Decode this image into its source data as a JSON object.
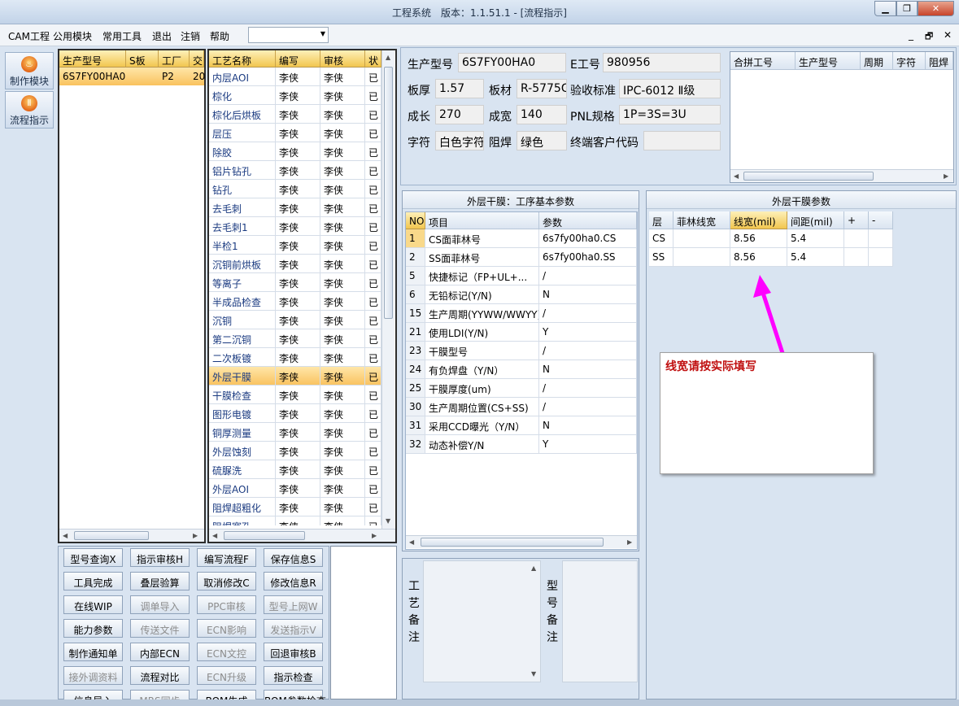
{
  "window": {
    "title": "工程系统　版本：1.1.51.1 - [流程指示]",
    "minimize": "▁",
    "restore": "❐",
    "close": "✕"
  },
  "menu": {
    "items": [
      "CAM工程",
      "公用模块",
      "常用工具",
      "退出",
      "注销",
      "帮助"
    ],
    "combo_value": "",
    "mdi_min": "_",
    "mdi_restore": "🗗",
    "mdi_close": "✕"
  },
  "sidebar": {
    "items": [
      {
        "label": "制作模块",
        "icon": "flame-icon"
      },
      {
        "label": "流程指示",
        "icon": "pause-icon"
      }
    ]
  },
  "product_grid": {
    "headers": [
      "生产型号",
      "S板",
      "工厂",
      "交"
    ],
    "rows": [
      [
        "6S7FY00HA0",
        "",
        "P2",
        "20"
      ]
    ]
  },
  "process_grid": {
    "headers": [
      "工艺名称",
      "编写",
      "审核",
      "状"
    ],
    "rows": [
      [
        "内层AOI",
        "李侠",
        "李侠",
        "已"
      ],
      [
        "棕化",
        "李侠",
        "李侠",
        "已"
      ],
      [
        "棕化后烘板",
        "李侠",
        "李侠",
        "已"
      ],
      [
        "层压",
        "李侠",
        "李侠",
        "已"
      ],
      [
        "除胶",
        "李侠",
        "李侠",
        "已"
      ],
      [
        "铝片钻孔",
        "李侠",
        "李侠",
        "已"
      ],
      [
        "钻孔",
        "李侠",
        "李侠",
        "已"
      ],
      [
        "去毛刺",
        "李侠",
        "李侠",
        "已"
      ],
      [
        "去毛刺1",
        "李侠",
        "李侠",
        "已"
      ],
      [
        "半检1",
        "李侠",
        "李侠",
        "已"
      ],
      [
        "沉铜前烘板",
        "李侠",
        "李侠",
        "已"
      ],
      [
        "等离子",
        "李侠",
        "李侠",
        "已"
      ],
      [
        "半成品检查",
        "李侠",
        "李侠",
        "已"
      ],
      [
        "沉铜",
        "李侠",
        "李侠",
        "已"
      ],
      [
        "第二沉铜",
        "李侠",
        "李侠",
        "已"
      ],
      [
        "二次板镀",
        "李侠",
        "李侠",
        "已"
      ],
      [
        "外层干膜",
        "李侠",
        "李侠",
        "已"
      ],
      [
        "干膜检查",
        "李侠",
        "李侠",
        "已"
      ],
      [
        "图形电镀",
        "李侠",
        "李侠",
        "已"
      ],
      [
        "铜厚测量",
        "李侠",
        "李侠",
        "已"
      ],
      [
        "外层蚀刻",
        "李侠",
        "李侠",
        "已"
      ],
      [
        "硫脲洗",
        "李侠",
        "李侠",
        "已"
      ],
      [
        "外层AOI",
        "李侠",
        "李侠",
        "已"
      ],
      [
        "阻焊超粗化",
        "李侠",
        "李侠",
        "已"
      ],
      [
        "阻焊塞孔",
        "李侠",
        "李侠",
        "已"
      ]
    ],
    "selected_index": 16
  },
  "buttons": {
    "rows": [
      [
        {
          "label": "型号查询X",
          "enabled": true
        },
        {
          "label": "指示审核H",
          "enabled": true
        },
        {
          "label": "编写流程F",
          "enabled": true
        },
        {
          "label": "保存信息S",
          "enabled": true
        }
      ],
      [
        {
          "label": "工具完成",
          "enabled": true
        },
        {
          "label": "叠层验算",
          "enabled": true
        },
        {
          "label": "取消修改C",
          "enabled": true
        },
        {
          "label": "修改信息R",
          "enabled": true
        }
      ],
      [
        {
          "label": "在线WIP",
          "enabled": true
        },
        {
          "label": "调单导入",
          "enabled": false
        },
        {
          "label": "PPC审核",
          "enabled": false
        },
        {
          "label": "型号上网W",
          "enabled": false
        }
      ],
      [
        {
          "label": "能力参数",
          "enabled": true
        },
        {
          "label": "传送文件",
          "enabled": false
        },
        {
          "label": "ECN影响",
          "enabled": false
        },
        {
          "label": "发送指示V",
          "enabled": false
        }
      ],
      [
        {
          "label": "制作通知单",
          "enabled": true
        },
        {
          "label": "内部ECN",
          "enabled": true
        },
        {
          "label": "ECN文控",
          "enabled": false
        },
        {
          "label": "回退审核B",
          "enabled": true
        }
      ],
      [
        {
          "label": "接外调资料",
          "enabled": false
        },
        {
          "label": "流程对比",
          "enabled": true
        },
        {
          "label": "ECN升级",
          "enabled": false
        },
        {
          "label": "指示检查",
          "enabled": true
        }
      ],
      [
        {
          "label": "信息导入",
          "enabled": true
        },
        {
          "label": "MRS同步",
          "enabled": false
        },
        {
          "label": "BOM生成",
          "enabled": true
        },
        {
          "label": "BOM参数检查",
          "enabled": true
        }
      ]
    ]
  },
  "info": {
    "model_label": "生产型号",
    "model_value": "6S7FY00HA0",
    "e_label": "E工号",
    "e_value": "980956",
    "thickness_label": "板厚",
    "thickness_value": "1.57",
    "material_label": "板材",
    "material_value": "R-5775G",
    "standard_label": "验收标准",
    "standard_value": "IPC-6012 Ⅱ级",
    "length_label": "成长",
    "length_value": "270",
    "width_label": "成宽",
    "width_value": "140",
    "pnl_label": "PNL规格",
    "pnl_value": "1P=3S=3U",
    "char_label": "字符",
    "char_value": "白色字符",
    "mask_label": "阻焊",
    "mask_value": "绿色",
    "customer_label": "终端客户代码",
    "customer_value": ""
  },
  "combine_grid": {
    "headers": [
      "合拼工号",
      "生产型号",
      "周期",
      "字符",
      "阻焊"
    ]
  },
  "params": {
    "title": "外层干膜：工序基本参数",
    "headers": [
      "NO",
      "项目",
      "参数"
    ],
    "rows": [
      [
        "1",
        "CS面菲林号",
        "6s7fy00ha0.CS"
      ],
      [
        "2",
        "SS面菲林号",
        "6s7fy00ha0.SS"
      ],
      [
        "5",
        "快捷标记（FP+UL+...",
        "/"
      ],
      [
        "6",
        "无铅标记(Y/N)",
        "N"
      ],
      [
        "15",
        "生产周期(YYWW/WWYY)",
        "/"
      ],
      [
        "21",
        "使用LDI(Y/N)",
        "Y"
      ],
      [
        "23",
        "干膜型号",
        "/"
      ],
      [
        "24",
        "有负焊盘（Y/N）",
        "N"
      ],
      [
        "25",
        "干膜厚度(um)",
        "/"
      ],
      [
        "30",
        "生产周期位置(CS+SS)",
        "/"
      ],
      [
        "31",
        "采用CCD曝光（Y/N）",
        "N"
      ],
      [
        "32",
        "动态补偿Y/N",
        "Y"
      ]
    ]
  },
  "dryfilm": {
    "title": "外层干膜参数",
    "headers": [
      "层",
      "菲林线宽",
      "线宽(mil)",
      "间距(mil)",
      "+",
      "-"
    ],
    "rows": [
      [
        "CS",
        "",
        "8.56",
        "5.4",
        "",
        ""
      ],
      [
        "SS",
        "",
        "8.56",
        "5.4",
        "",
        ""
      ]
    ]
  },
  "annotation": {
    "text": "线宽请按实际填写",
    "color": "#ff00ff"
  },
  "remarks": {
    "process_label": "工艺备注",
    "model_label": "型号备注"
  }
}
